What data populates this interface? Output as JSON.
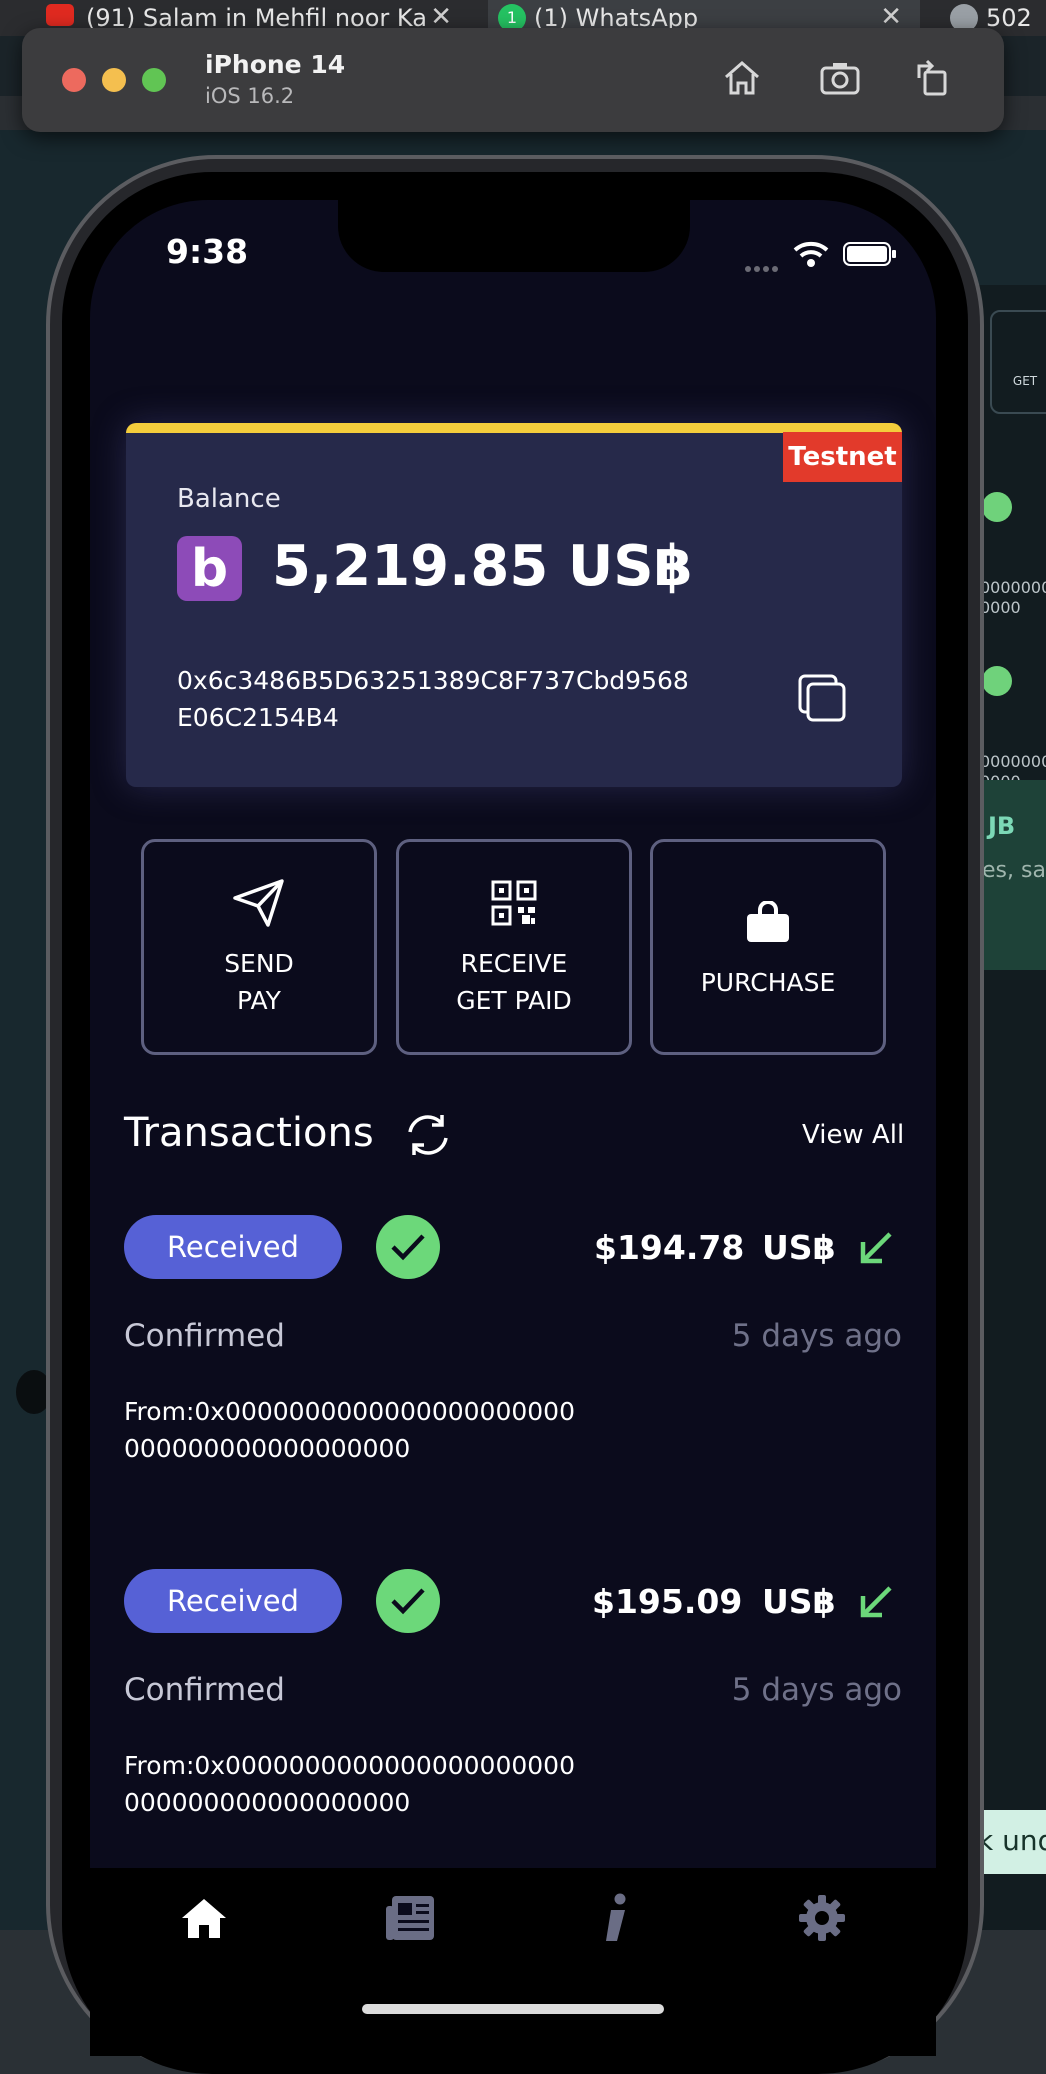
{
  "browser_tabs": [
    {
      "title": "(91) Salam in Mehfil noor Ka",
      "close": "✕"
    },
    {
      "title": "(1) WhatsApp",
      "badge": "1",
      "close": "✕"
    },
    {
      "title": "502"
    }
  ],
  "background_app": {
    "get_label": "GET",
    "zeros_1": "00000000\n0000",
    "zeros_2": "00000000\n0000",
    "banner_title": "JB",
    "banner_text": "es, sa",
    "toast_text": "k und"
  },
  "simulator": {
    "device_name": "iPhone 14",
    "os_version": "iOS 16.2",
    "icons": [
      "home-icon",
      "screenshot-icon",
      "rotate-icon"
    ]
  },
  "status_bar": {
    "time": "9:38"
  },
  "balance_card": {
    "network_badge": "Testnet",
    "label": "Balance",
    "coin_glyph": "b",
    "amount": "5,219.85 US฿",
    "address": "0x6c3486B5D63251389C8F737Cbd9568E06C2154B4"
  },
  "actions": [
    {
      "line1": "SEND",
      "line2": "PAY",
      "icon": "send-icon"
    },
    {
      "line1": "RECEIVE",
      "line2": "GET PAID",
      "icon": "qr-code-icon"
    },
    {
      "line1": "PURCHASE",
      "line2": "",
      "icon": "shopping-bag-icon"
    }
  ],
  "transactions": {
    "title": "Transactions",
    "view_all": "View All",
    "items": [
      {
        "type": "Received",
        "amount": "$194.78",
        "currency": "US฿",
        "status": "Confirmed",
        "when": "5 days ago",
        "from": "From:0x0000000000000000000000000000000000000000"
      },
      {
        "type": "Received",
        "amount": "$195.09",
        "currency": "US฿",
        "status": "Confirmed",
        "when": "5 days ago",
        "from": "From:0x0000000000000000000000000000000000000000"
      }
    ]
  },
  "bottom_nav": [
    "home-icon",
    "news-icon",
    "info-icon",
    "settings-icon"
  ],
  "colors": {
    "card_bg": "#26294a",
    "card_accent": "#f4cd3c",
    "testnet": "#e23a2b",
    "pill": "#5661d6",
    "success": "#6cd87a",
    "coin": "#8d4bb8"
  }
}
